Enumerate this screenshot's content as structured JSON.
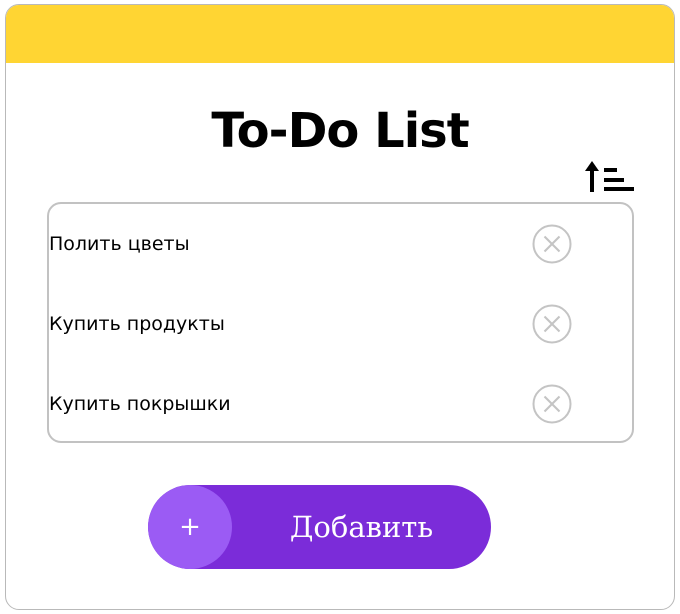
{
  "app": {
    "title": "To-Do List"
  },
  "header": {
    "bar_color": "#ffd533"
  },
  "toolbar": {
    "sort_icon": "sort-ascending-icon"
  },
  "tasks": [
    {
      "text": "Полить цветы",
      "delete_icon": "close-circle-icon"
    },
    {
      "text": "Купить продукты",
      "delete_icon": "close-circle-icon"
    },
    {
      "text": "Купить покрышки",
      "delete_icon": "close-circle-icon"
    }
  ],
  "add_button": {
    "plus": "+",
    "label": "Добавить",
    "color": "#7b2cd9",
    "plus_color": "#9b5bf4"
  }
}
